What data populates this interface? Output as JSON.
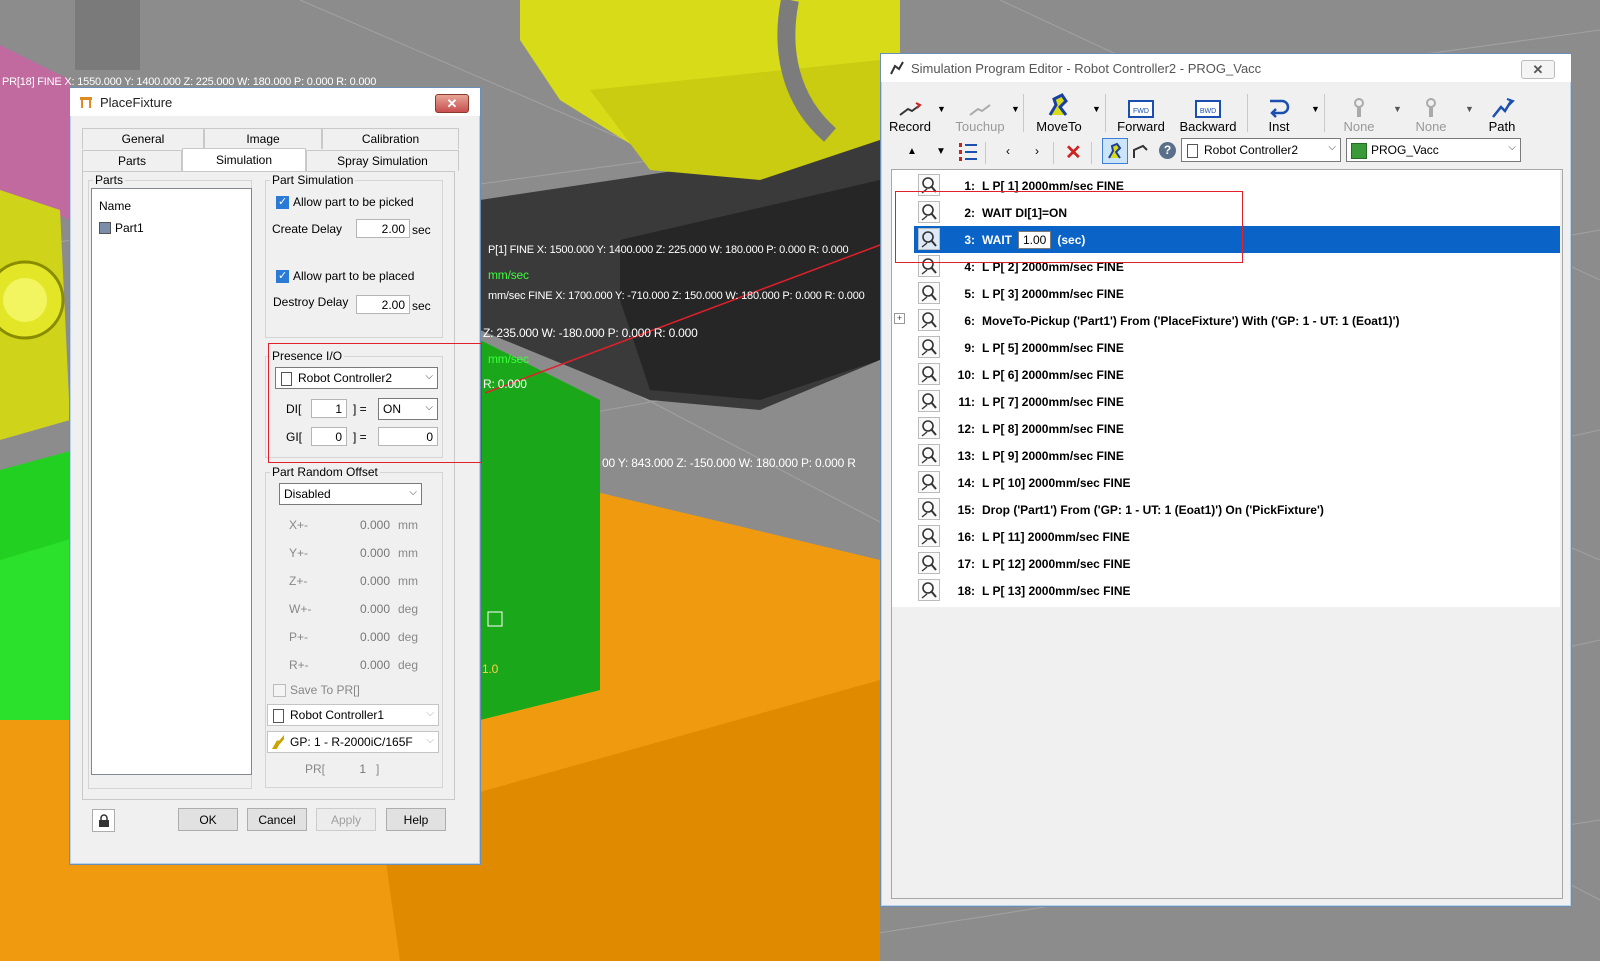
{
  "scene": {
    "overlay_top_left": "PR[18] FINE X: 1550.000 Y: 1400.000 Z: 225.000 W: 180.000 P: 0.000 R: 0.000",
    "overlay_mid_1": "P[1] FINE X: 1500.000 Y: 1400.000 Z: 225.000 W: 180.000 P: 0.000 R: 0.000",
    "overlay_mid_speed1": "mm/sec",
    "overlay_mid_2": "mm/sec FINE X: 1700.000 Y: -710.000 Z: 150.000 W: 180.000 P: 0.000 R: 0.000",
    "overlay_mid_3": "Z: 235.000 W: -180.000 P: 0.000 R: 0.000",
    "overlay_mid_speed2": "mm/sec",
    "overlay_mid_4": "R: 0.000",
    "overlay_right": "00 Y: 843.000 Z: -150.000 W: 180.000 P: 0.000 R",
    "overlay_bottom": "1.0"
  },
  "place_fixture": {
    "title": "PlaceFixture",
    "close_label": "✕",
    "tabs_row1": [
      "General",
      "Image",
      "Calibration"
    ],
    "tabs_row2": [
      "Parts",
      "Simulation",
      "Spray Simulation"
    ],
    "parts_group": "Parts",
    "parts_header": "Name",
    "parts_items": [
      "Part1"
    ],
    "part_sim_group": "Part Simulation",
    "allow_picked": "Allow part to be picked",
    "create_delay_label": "Create Delay",
    "create_delay_value": "2.00",
    "sec1": "sec",
    "allow_placed": "Allow part to be placed",
    "destroy_delay_label": "Destroy Delay",
    "destroy_delay_value": "2.00",
    "sec2": "sec",
    "presence_group": "Presence I/O",
    "presence_controller": "Robot Controller2",
    "di_label": "DI[",
    "di_index": "1",
    "di_eq": "] =",
    "di_value": "ON",
    "gi_label": "GI[",
    "gi_index": "0",
    "gi_eq": "] =",
    "gi_value": "0",
    "offset_group": "Part Random Offset",
    "offset_mode": "Disabled",
    "offsets": [
      {
        "label": "X+-",
        "value": "0.000",
        "unit": "mm"
      },
      {
        "label": "Y+-",
        "value": "0.000",
        "unit": "mm"
      },
      {
        "label": "Z+-",
        "value": "0.000",
        "unit": "mm"
      },
      {
        "label": "W+-",
        "value": "0.000",
        "unit": "deg"
      },
      {
        "label": "P+-",
        "value": "0.000",
        "unit": "deg"
      },
      {
        "label": "R+-",
        "value": "0.000",
        "unit": "deg"
      }
    ],
    "save_pr": "Save To PR[]",
    "pr_controller": "Robot Controller1",
    "pr_group": "GP: 1 - R-2000iC/165F",
    "pr_label": "PR[",
    "pr_index": "1",
    "pr_close": "]",
    "buttons": {
      "ok": "OK",
      "cancel": "Cancel",
      "apply": "Apply",
      "help": "Help"
    }
  },
  "editor": {
    "title": "Simulation Program Editor - Robot Controller2 - PROG_Vacc",
    "close_label": "✕",
    "toolbar": [
      "Record",
      "Touchup",
      "MoveTo",
      "Forward",
      "Backward",
      "Inst",
      "None",
      "None",
      "Path"
    ],
    "controller_combo": "Robot Controller2",
    "program_combo": "PROG_Vacc",
    "lines": [
      {
        "num": "1:",
        "text": "L P[ 1] 2000mm/sec FINE"
      },
      {
        "num": "2:",
        "text": "WAIT DI[1]=ON"
      },
      {
        "num": "3:",
        "text": "WAIT",
        "value": "1.00",
        "suffix": "(sec)"
      },
      {
        "num": "4:",
        "text": "L P[ 2] 2000mm/sec FINE"
      },
      {
        "num": "5:",
        "text": "L P[ 3] 2000mm/sec FINE"
      },
      {
        "num": "6:",
        "text": "MoveTo-Pickup ('Part1') From ('PlaceFixture') With ('GP: 1 - UT: 1  (Eoat1)')"
      },
      {
        "num": "9:",
        "text": "L P[ 5] 2000mm/sec FINE"
      },
      {
        "num": "10:",
        "text": "L P[ 6] 2000mm/sec FINE"
      },
      {
        "num": "11:",
        "text": "L P[ 7] 2000mm/sec FINE"
      },
      {
        "num": "12:",
        "text": "L P[ 8] 2000mm/sec FINE"
      },
      {
        "num": "13:",
        "text": "L P[ 9] 2000mm/sec FINE"
      },
      {
        "num": "14:",
        "text": "L P[ 10] 2000mm/sec FINE"
      },
      {
        "num": "15:",
        "text": "Drop ('Part1') From ('GP: 1 - UT: 1  (Eoat1)') On ('PickFixture')"
      },
      {
        "num": "16:",
        "text": "L P[ 11] 2000mm/sec FINE"
      },
      {
        "num": "17:",
        "text": "L P[ 12] 2000mm/sec FINE"
      },
      {
        "num": "18:",
        "text": "L P[ 13] 2000mm/sec FINE"
      }
    ],
    "expander_label": "+"
  }
}
